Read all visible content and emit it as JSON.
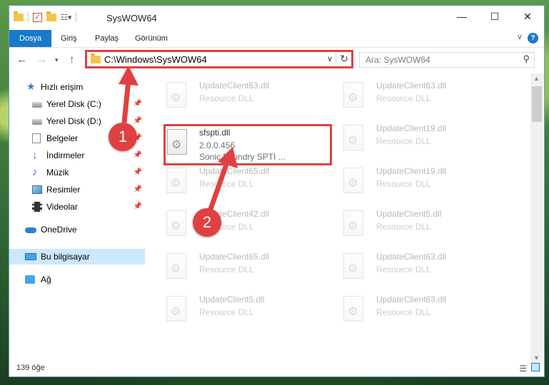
{
  "window": {
    "title": "SysWOW64"
  },
  "ribbon": {
    "tabs": [
      "Dosya",
      "Giriş",
      "Paylaş",
      "Görünüm"
    ],
    "help": "?"
  },
  "nav": {
    "address": "C:\\Windows\\SysWOW64",
    "search_placeholder": "Ara: SysWOW64"
  },
  "sidebar": {
    "items": [
      {
        "label": "Hızlı erişim",
        "icon": "star-icon"
      },
      {
        "label": "Yerel Disk (C:)",
        "icon": "disk-icon"
      },
      {
        "label": "Yerel Disk (D:)",
        "icon": "disk-icon"
      },
      {
        "label": "Belgeler",
        "icon": "documents-icon"
      },
      {
        "label": "İndirmeler",
        "icon": "download-icon"
      },
      {
        "label": "Müzik",
        "icon": "music-icon"
      },
      {
        "label": "Resimler",
        "icon": "pictures-icon"
      },
      {
        "label": "Videolar",
        "icon": "videos-icon"
      },
      {
        "label": "OneDrive",
        "icon": "onedrive-icon"
      },
      {
        "label": "Bu bilgisayar",
        "icon": "this-pc-icon"
      },
      {
        "label": "Ağ",
        "icon": "network-icon"
      }
    ]
  },
  "files": {
    "left": [
      {
        "name": "UpdateClient63.dll",
        "sub1": "Resource DLL"
      },
      {
        "name": "sfspti.dll",
        "sub1": "2.0.0.456",
        "sub2": "Sonic Foundry SPTI ..."
      },
      {
        "name": "UpdateClient65.dll",
        "sub1": "Resource DLL"
      },
      {
        "name": "UpdateClient42.dll",
        "sub1": "Resource DLL"
      },
      {
        "name": "UpdateClient65.dll",
        "sub1": "Resource DLL"
      },
      {
        "name": "UpdateClient5.dll",
        "sub1": "Resource DLL"
      }
    ],
    "right": [
      {
        "name": "UpdateClient63.dll",
        "sub1": "Resource DLL"
      },
      {
        "name": "UpdateClient19.dll",
        "sub1": "Resource DLL"
      },
      {
        "name": "UpdateClient19.dll",
        "sub1": "Resource DLL"
      },
      {
        "name": "UpdateClient5.dll",
        "sub1": "Resource DLL"
      },
      {
        "name": "UpdateClient63.dll",
        "sub1": "Resource DLL"
      },
      {
        "name": "UpdateClient63.dll",
        "sub1": "Resource DLL"
      }
    ]
  },
  "status": {
    "count": "139 öğe"
  },
  "annotations": {
    "step1": "1",
    "step2": "2",
    "color": "#e04040"
  }
}
